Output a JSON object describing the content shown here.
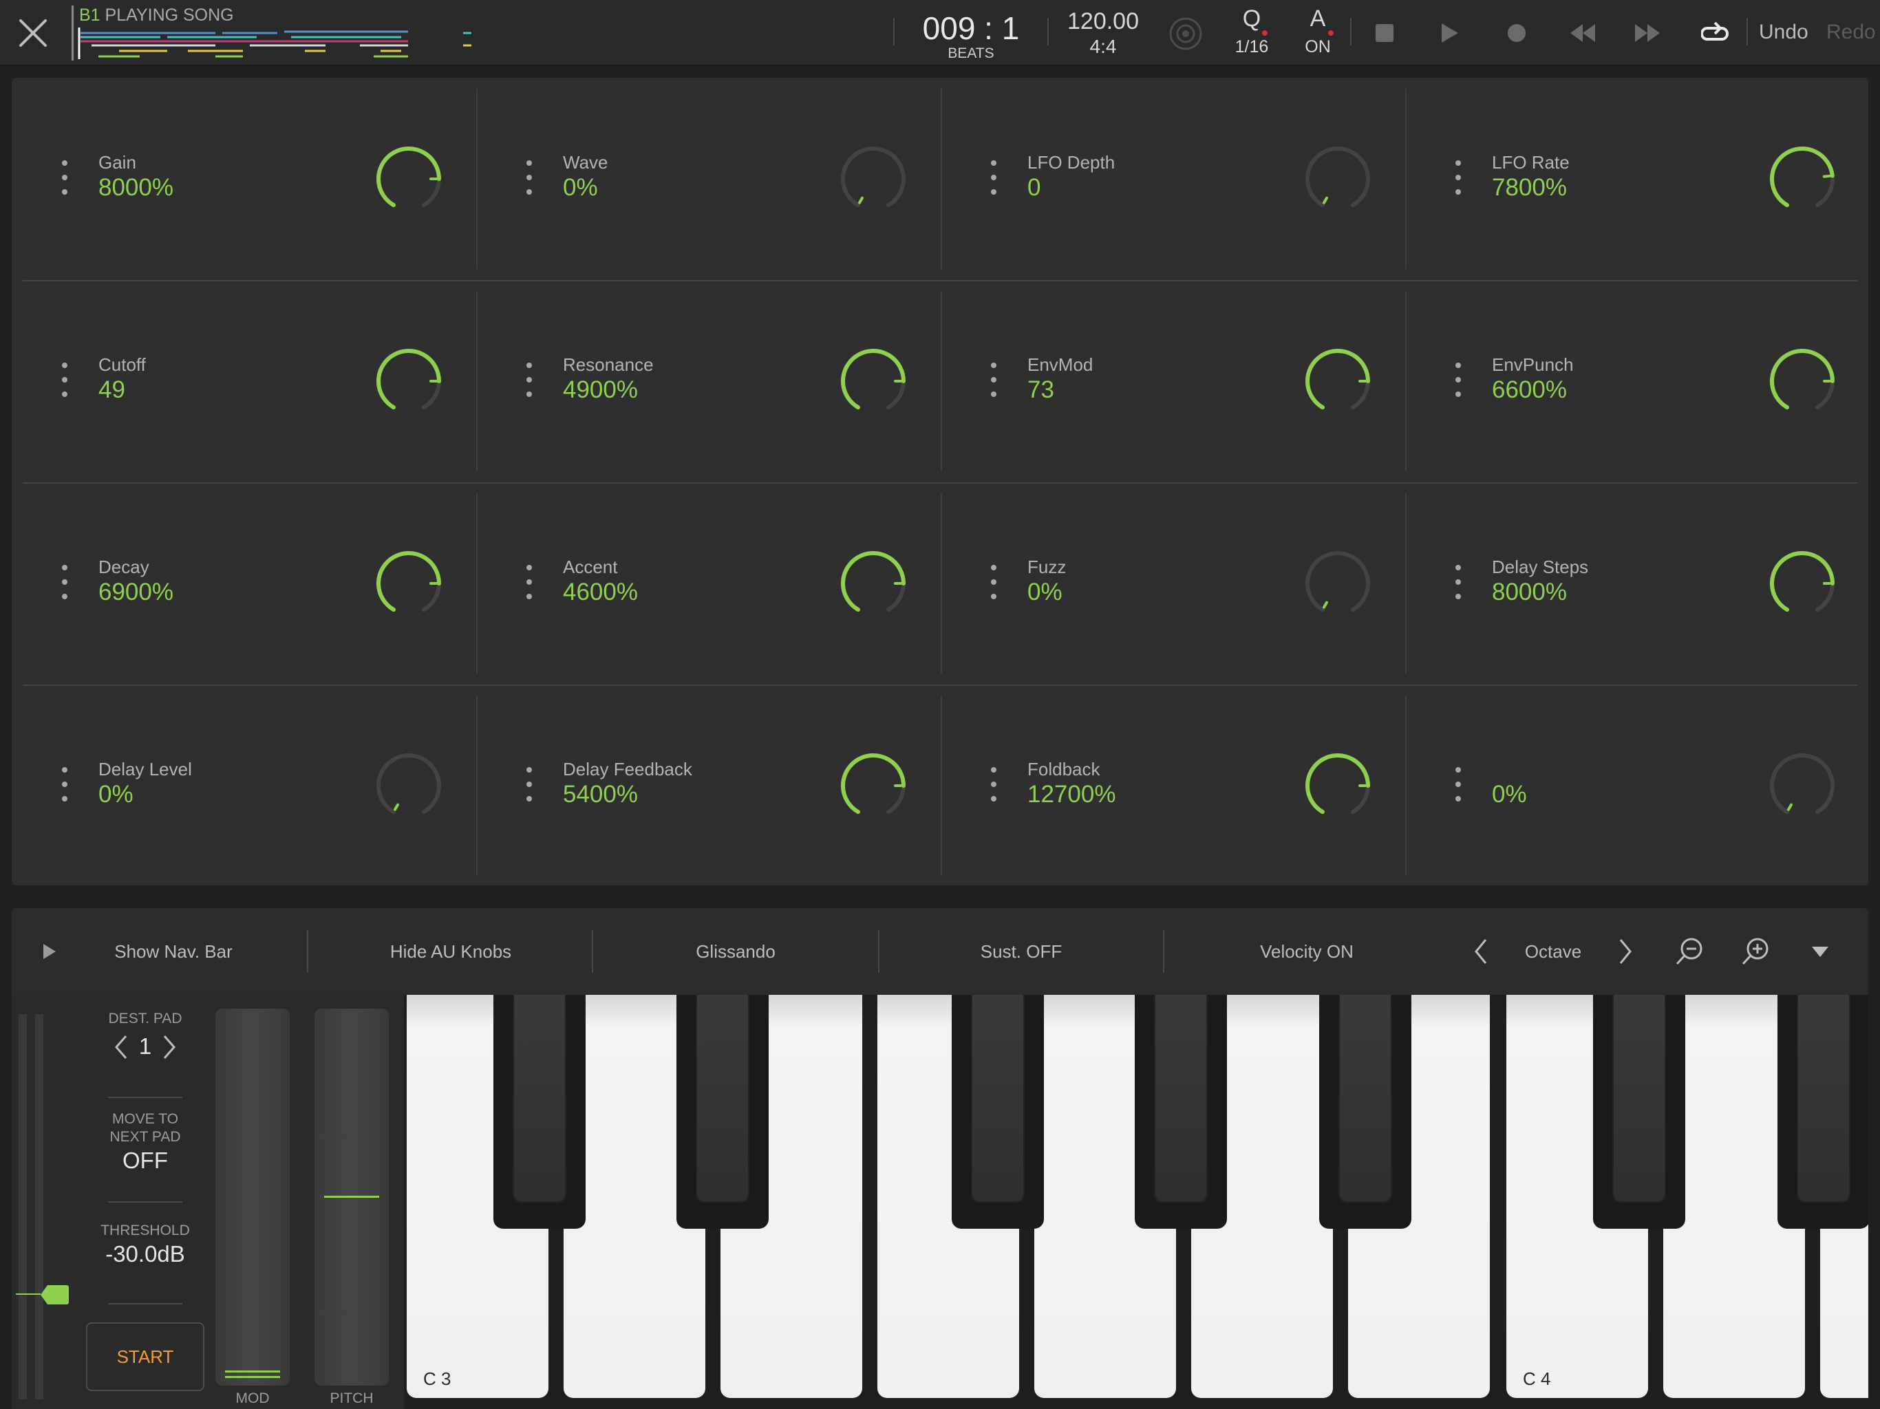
{
  "header": {
    "song_prefix": "B1",
    "song_title": "PLAYING SONG",
    "position": "009 : 1",
    "position_unit": "BEATS",
    "tempo": "120.00",
    "time_signature": "4:4",
    "quantize_label": "Q",
    "quantize_value": "1/16",
    "automation_label": "A",
    "automation_value": "ON",
    "undo_label": "Undo",
    "redo_label": "Redo"
  },
  "params": [
    {
      "name": "Gain",
      "value": "8000%",
      "level": 0.8
    },
    {
      "name": "Wave",
      "value": "0%",
      "level": 0.0
    },
    {
      "name": "LFO Depth",
      "value": "0",
      "level": 0.0
    },
    {
      "name": "LFO Rate",
      "value": "7800%",
      "level": 0.78
    },
    {
      "name": "Cutoff",
      "value": "49",
      "level": 0.8
    },
    {
      "name": "Resonance",
      "value": "4900%",
      "level": 0.8
    },
    {
      "name": "EnvMod",
      "value": "73",
      "level": 0.8
    },
    {
      "name": "EnvPunch",
      "value": "6600%",
      "level": 0.8
    },
    {
      "name": "Decay",
      "value": "6900%",
      "level": 0.8
    },
    {
      "name": "Accent",
      "value": "4600%",
      "level": 0.8
    },
    {
      "name": "Fuzz",
      "value": "0%",
      "level": 0.0
    },
    {
      "name": "Delay Steps",
      "value": "8000%",
      "level": 0.8
    },
    {
      "name": "Delay Level",
      "value": "0%",
      "level": 0.0
    },
    {
      "name": "Delay Feedback",
      "value": "5400%",
      "level": 0.8
    },
    {
      "name": "Foldback",
      "value": "12700%",
      "level": 0.8
    },
    {
      "name": "",
      "value": "0%",
      "level": 0.0
    }
  ],
  "toolbar": {
    "show_nav": "Show Nav. Bar",
    "hide_au": "Hide AU Knobs",
    "glissando": "Glissando",
    "sustain": "Sust. OFF",
    "velocity": "Velocity ON",
    "octave": "Octave"
  },
  "left": {
    "dest_pad_label": "DEST. PAD",
    "dest_pad_value": "1",
    "move_label_1": "MOVE TO",
    "move_label_2": "NEXT PAD",
    "move_value": "OFF",
    "threshold_label": "THRESHOLD",
    "threshold_value": "-30.0dB",
    "start_label": "START",
    "mod_label": "MOD",
    "pitch_label": "PITCH"
  },
  "piano": {
    "c3_label": "C 3",
    "c4_label": "C 4"
  },
  "colors": {
    "accent": "#8fd14f",
    "start": "#f39c3c"
  }
}
